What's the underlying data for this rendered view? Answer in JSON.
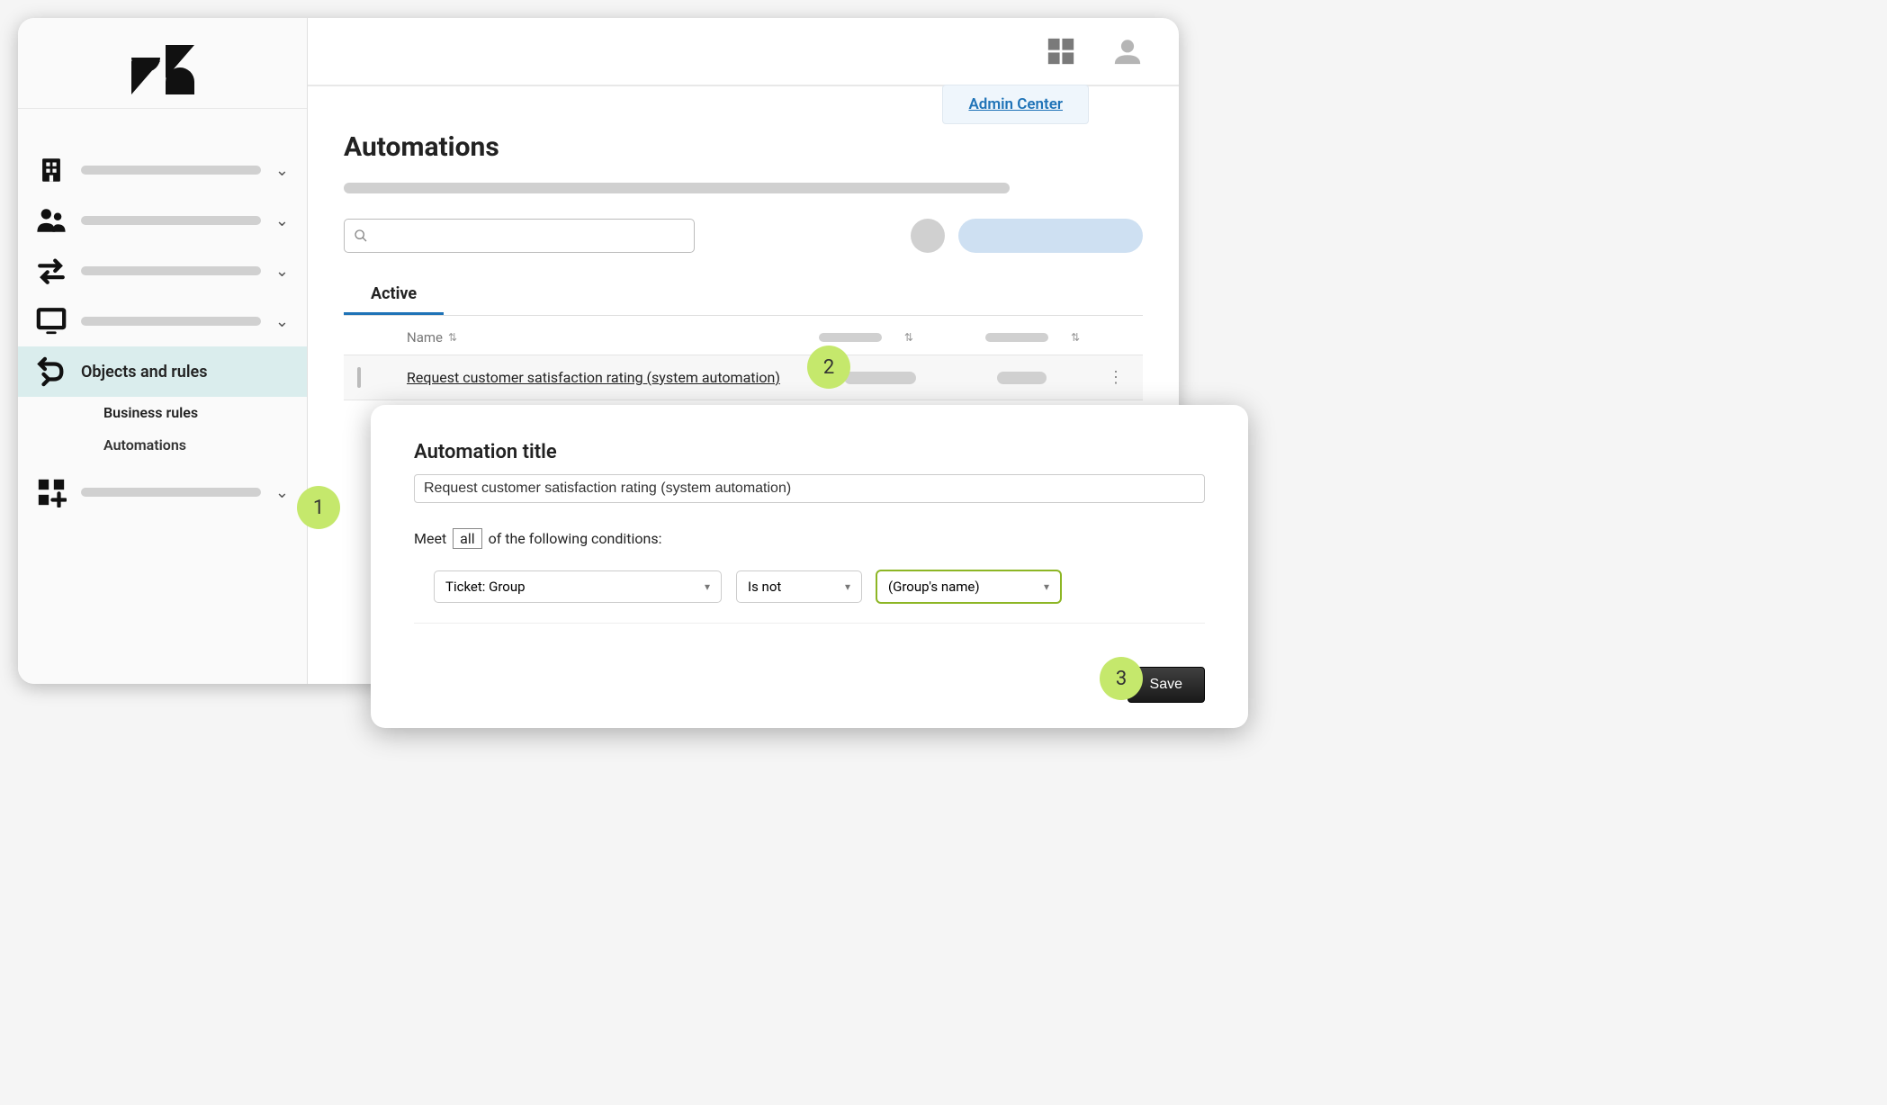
{
  "header": {
    "admin_center": "Admin Center"
  },
  "sidebar": {
    "active_section": "Objects and rules",
    "sub_section_label": "Business rules",
    "active_item": "Automations"
  },
  "page": {
    "title": "Automations",
    "active_tab": "Active",
    "columns": {
      "name": "Name"
    },
    "rows": [
      {
        "name": "Request customer satisfaction rating (system automation)"
      }
    ]
  },
  "detail": {
    "section_title": "Automation title",
    "title_value": "Request customer satisfaction rating (system automation)",
    "meet_prefix": "Meet",
    "meet_mode": "all",
    "meet_suffix": "of the following conditions:",
    "condition": {
      "field": "Ticket: Group",
      "operator": "Is not",
      "value": "(Group's name)"
    },
    "save_label": "Save"
  },
  "callouts": {
    "one": "1",
    "two": "2",
    "three": "3"
  }
}
